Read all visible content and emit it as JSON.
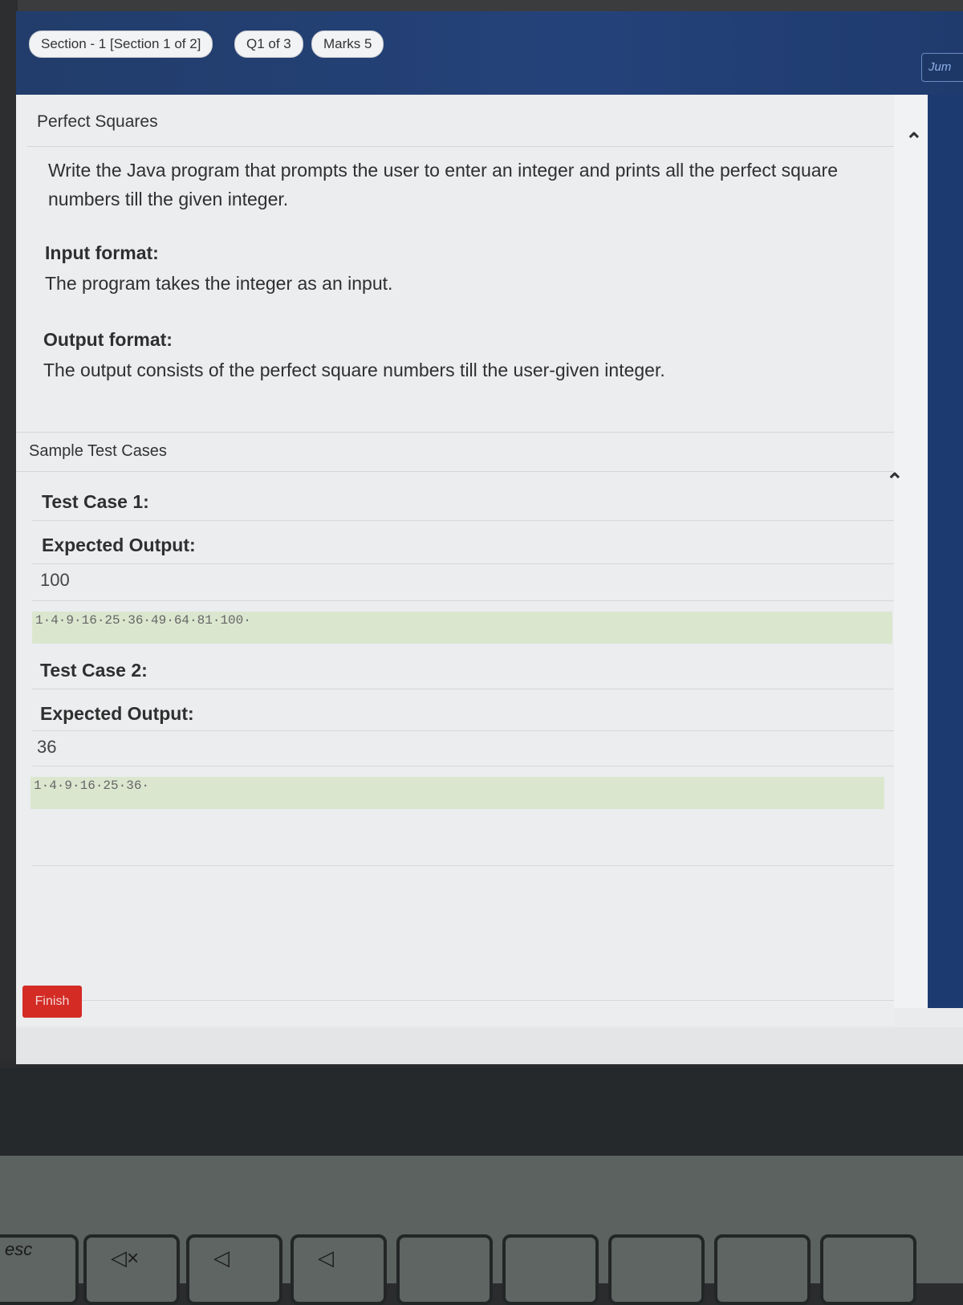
{
  "header": {
    "section_label": "Section - 1 [Section 1 of 2]",
    "question_label": "Q1 of 3",
    "marks_label": "Marks 5",
    "jump_label": "Jum"
  },
  "question": {
    "title": "Perfect Squares",
    "text": "Write the Java program that prompts the user to enter an integer and prints all the perfect square numbers till the given integer.",
    "input_format_heading": "Input format:",
    "input_format_text": "The program takes the integer as an input.",
    "output_format_heading": "Output format:",
    "output_format_text": "The output consists of the perfect square numbers till the user-given integer."
  },
  "samples": {
    "heading": "Sample Test Cases",
    "cases": [
      {
        "heading": "Test Case 1:",
        "expected_heading": "Expected Output:",
        "input": "100",
        "output": "1·4·9·16·25·36·49·64·81·100·"
      },
      {
        "heading": "Test Case 2:",
        "expected_heading": "Expected Output:",
        "input": "36",
        "output": "1·4·9·16·25·36·"
      }
    ]
  },
  "footer": {
    "finish_label": "Finish"
  },
  "keyboard": {
    "esc_label": "esc"
  }
}
